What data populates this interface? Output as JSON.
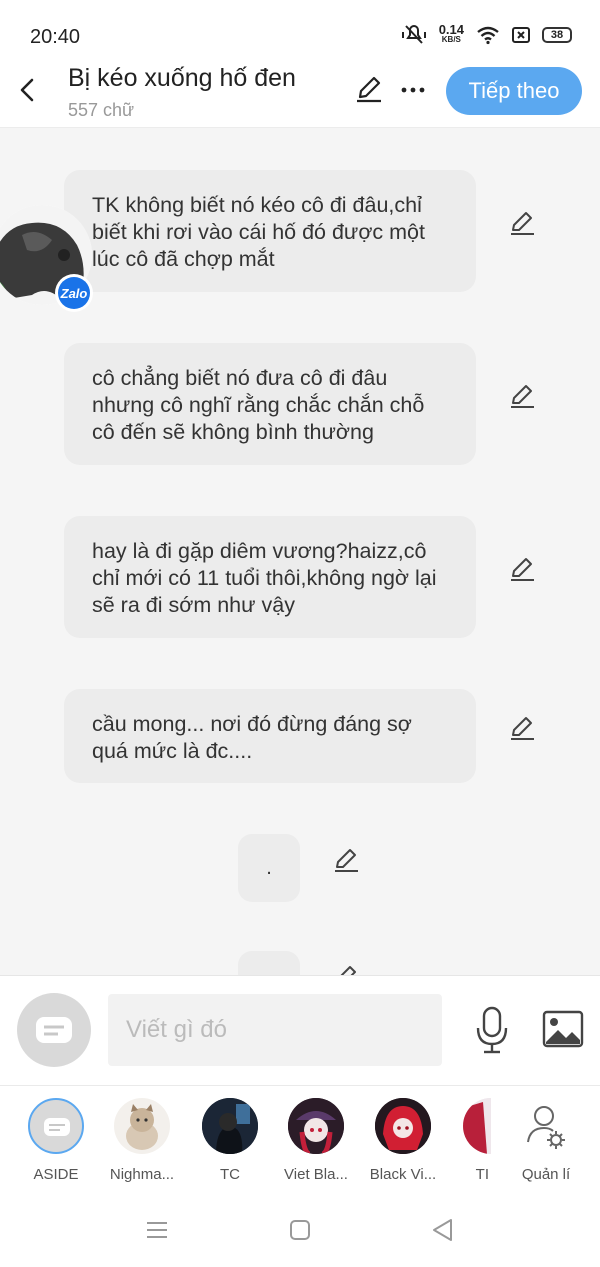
{
  "status": {
    "time": "20:40",
    "speed_value": "0.14",
    "speed_unit": "KB/S",
    "battery": "38"
  },
  "header": {
    "title": "Bị kéo xuống hố đen",
    "subtitle": "557 chữ",
    "next_label": "Tiếp theo"
  },
  "messages": [
    {
      "text": "TK không biết nó kéo cô đi đâu,chỉ biết khi rơi vào cái hố đó được một lúc cô đã chợp mắt"
    },
    {
      "text": "cô chẳng biết nó đưa cô đi đâu nhưng cô nghĩ rằng chắc chắn chỗ cô đến sẽ không bình thường"
    },
    {
      "text": "hay là đi gặp diêm vương?haizz,cô chỉ mới có 11 tuổi thôi,không ngờ lại sẽ ra đi sớm như vậy"
    },
    {
      "text": "cầu mong... nơi đó đừng đáng sợ quá mức là đc...."
    },
    {
      "text": "."
    }
  ],
  "zalo_badge": "Zalo",
  "input": {
    "placeholder": "Viết gì đó"
  },
  "characters": [
    {
      "name": "ASIDE"
    },
    {
      "name": "Nighma..."
    },
    {
      "name": "TC"
    },
    {
      "name": "Viet Bla..."
    },
    {
      "name": "Black Vi..."
    },
    {
      "name": "TI"
    },
    {
      "name": "Quản lí"
    }
  ],
  "colors": {
    "accent": "#5ba8f0",
    "bubble": "#ececec",
    "background": "#f5f5f5"
  }
}
